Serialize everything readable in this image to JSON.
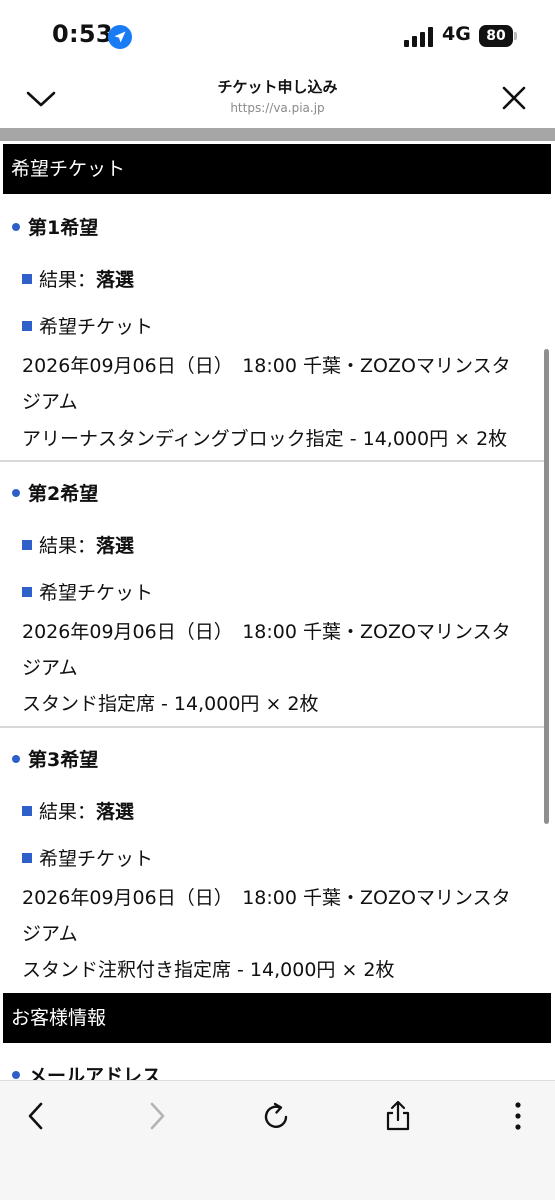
{
  "status_bar": {
    "time": "0:53",
    "network": "4G",
    "battery": "80"
  },
  "browser": {
    "page_title": "チケット申し込み",
    "url": "https://va.pia.jp"
  },
  "sections": {
    "ticket_header": "希望チケット",
    "customer_header": "お客様情報"
  },
  "preferences": [
    {
      "title": "第1希望",
      "result_label": "結果：",
      "result_value": "落選",
      "ticket_label": "希望チケット",
      "date_line": "2026年09月06日（日）　18:00  千葉・ZOZOマリンスタ",
      "venue_cont": "ジアム",
      "seat_line": "アリーナスタンディングブロック指定 - 14,000円 × 2枚"
    },
    {
      "title": "第2希望",
      "result_label": "結果：",
      "result_value": "落選",
      "ticket_label": "希望チケット",
      "date_line": "2026年09月06日（日）　18:00  千葉・ZOZOマリンスタ",
      "venue_cont": "ジアム",
      "seat_line": "スタンド指定席 - 14,000円 × 2枚"
    },
    {
      "title": "第3希望",
      "result_label": "結果：",
      "result_value": "落選",
      "ticket_label": "希望チケット",
      "date_line": "2026年09月06日（日）　18:00  千葉・ZOZOマリンスタ",
      "venue_cont": "ジアム",
      "seat_line": "スタンド注釈付き指定席 - 14,000円 × 2枚"
    }
  ],
  "customer": {
    "email_label": "メールアドレス"
  },
  "colors": {
    "accent_blue": "#2f5fc8",
    "header_bg": "#000000"
  },
  "icons": {
    "top_left": "chevron-down-icon",
    "top_right": "close-icon",
    "toolbar": [
      "back-icon",
      "forward-icon",
      "reload-icon",
      "share-icon",
      "more-icon"
    ]
  }
}
